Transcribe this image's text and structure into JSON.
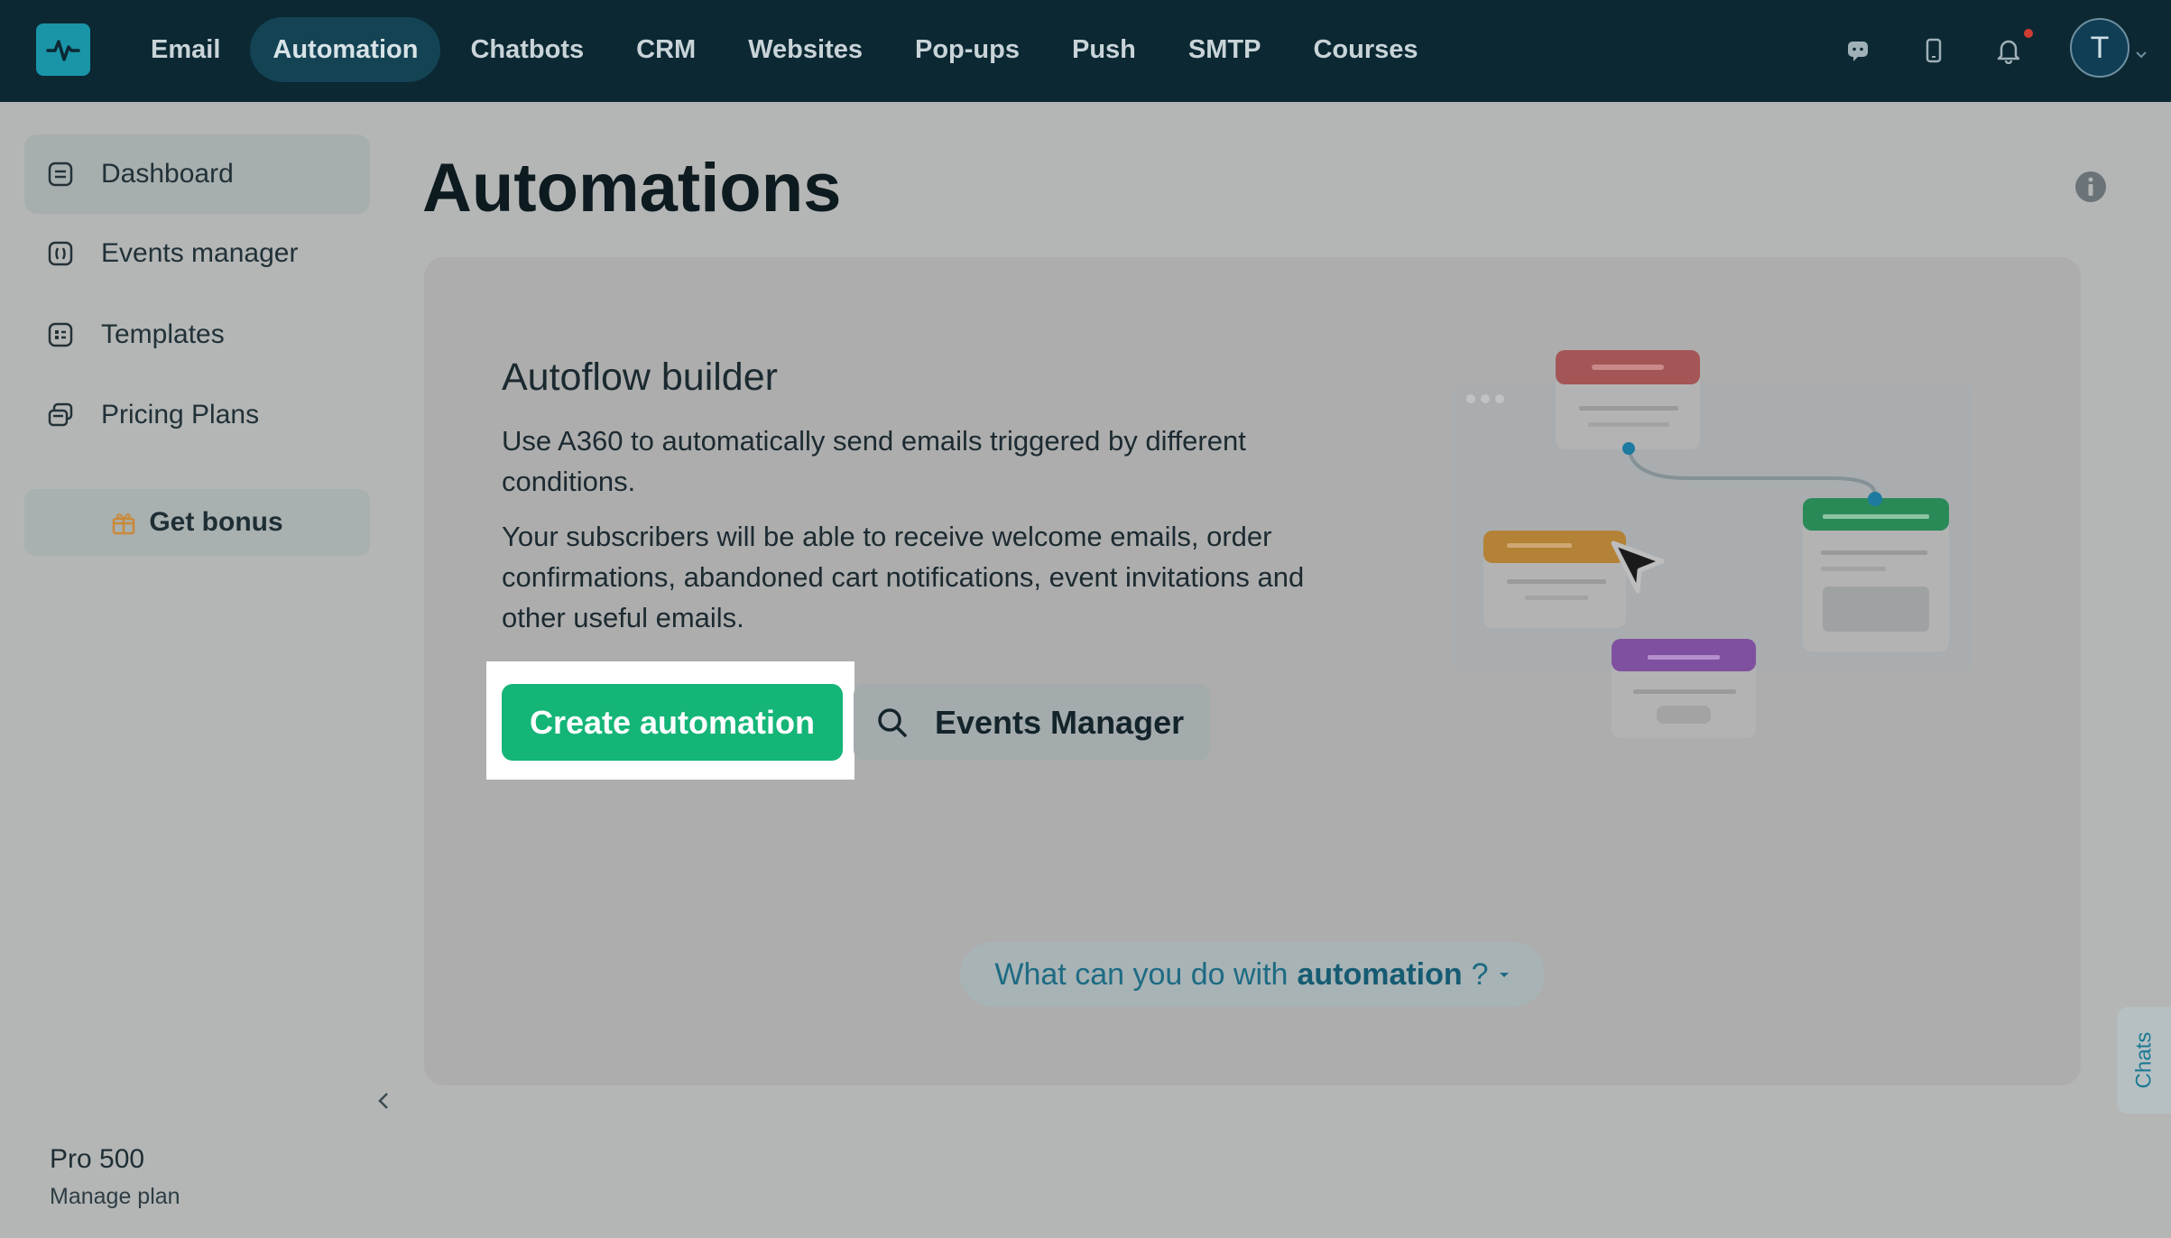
{
  "nav": {
    "items": [
      {
        "label": "Email",
        "active": false
      },
      {
        "label": "Automation",
        "active": true
      },
      {
        "label": "Chatbots",
        "active": false
      },
      {
        "label": "CRM",
        "active": false
      },
      {
        "label": "Websites",
        "active": false
      },
      {
        "label": "Pop-ups",
        "active": false
      },
      {
        "label": "Push",
        "active": false
      },
      {
        "label": "SMTP",
        "active": false
      },
      {
        "label": "Courses",
        "active": false
      }
    ],
    "avatar_letter": "T",
    "icons": [
      "chat-icon",
      "mobile-icon",
      "bell-icon"
    ]
  },
  "sidebar": {
    "items": [
      {
        "label": "Dashboard",
        "icon": "dashboard-icon",
        "active": true
      },
      {
        "label": "Events manager",
        "icon": "events-icon",
        "active": false
      },
      {
        "label": "Templates",
        "icon": "templates-icon",
        "active": false
      },
      {
        "label": "Pricing Plans",
        "icon": "pricing-icon",
        "active": false
      }
    ],
    "bonus_label": "Get bonus",
    "plan_name": "Pro 500",
    "manage_plan": "Manage plan"
  },
  "main": {
    "title": "Automations",
    "card": {
      "heading": "Autoflow builder",
      "paragraph1": "Use A360 to automatically send emails triggered by different conditions.",
      "paragraph2": "Your subscribers will be able to receive welcome emails, order confirmations, abandoned cart notifications, event invitations and other useful emails.",
      "create_button": "Create automation",
      "events_button": "Events Manager"
    },
    "help_pill": {
      "prefix": "What can you do with",
      "bold": "automation",
      "suffix": "?"
    }
  },
  "chats_tab": "Chats",
  "colors": {
    "topbar": "#0b2833",
    "accent_green": "#14b577",
    "overlay_bg": "#b4b6b5"
  }
}
